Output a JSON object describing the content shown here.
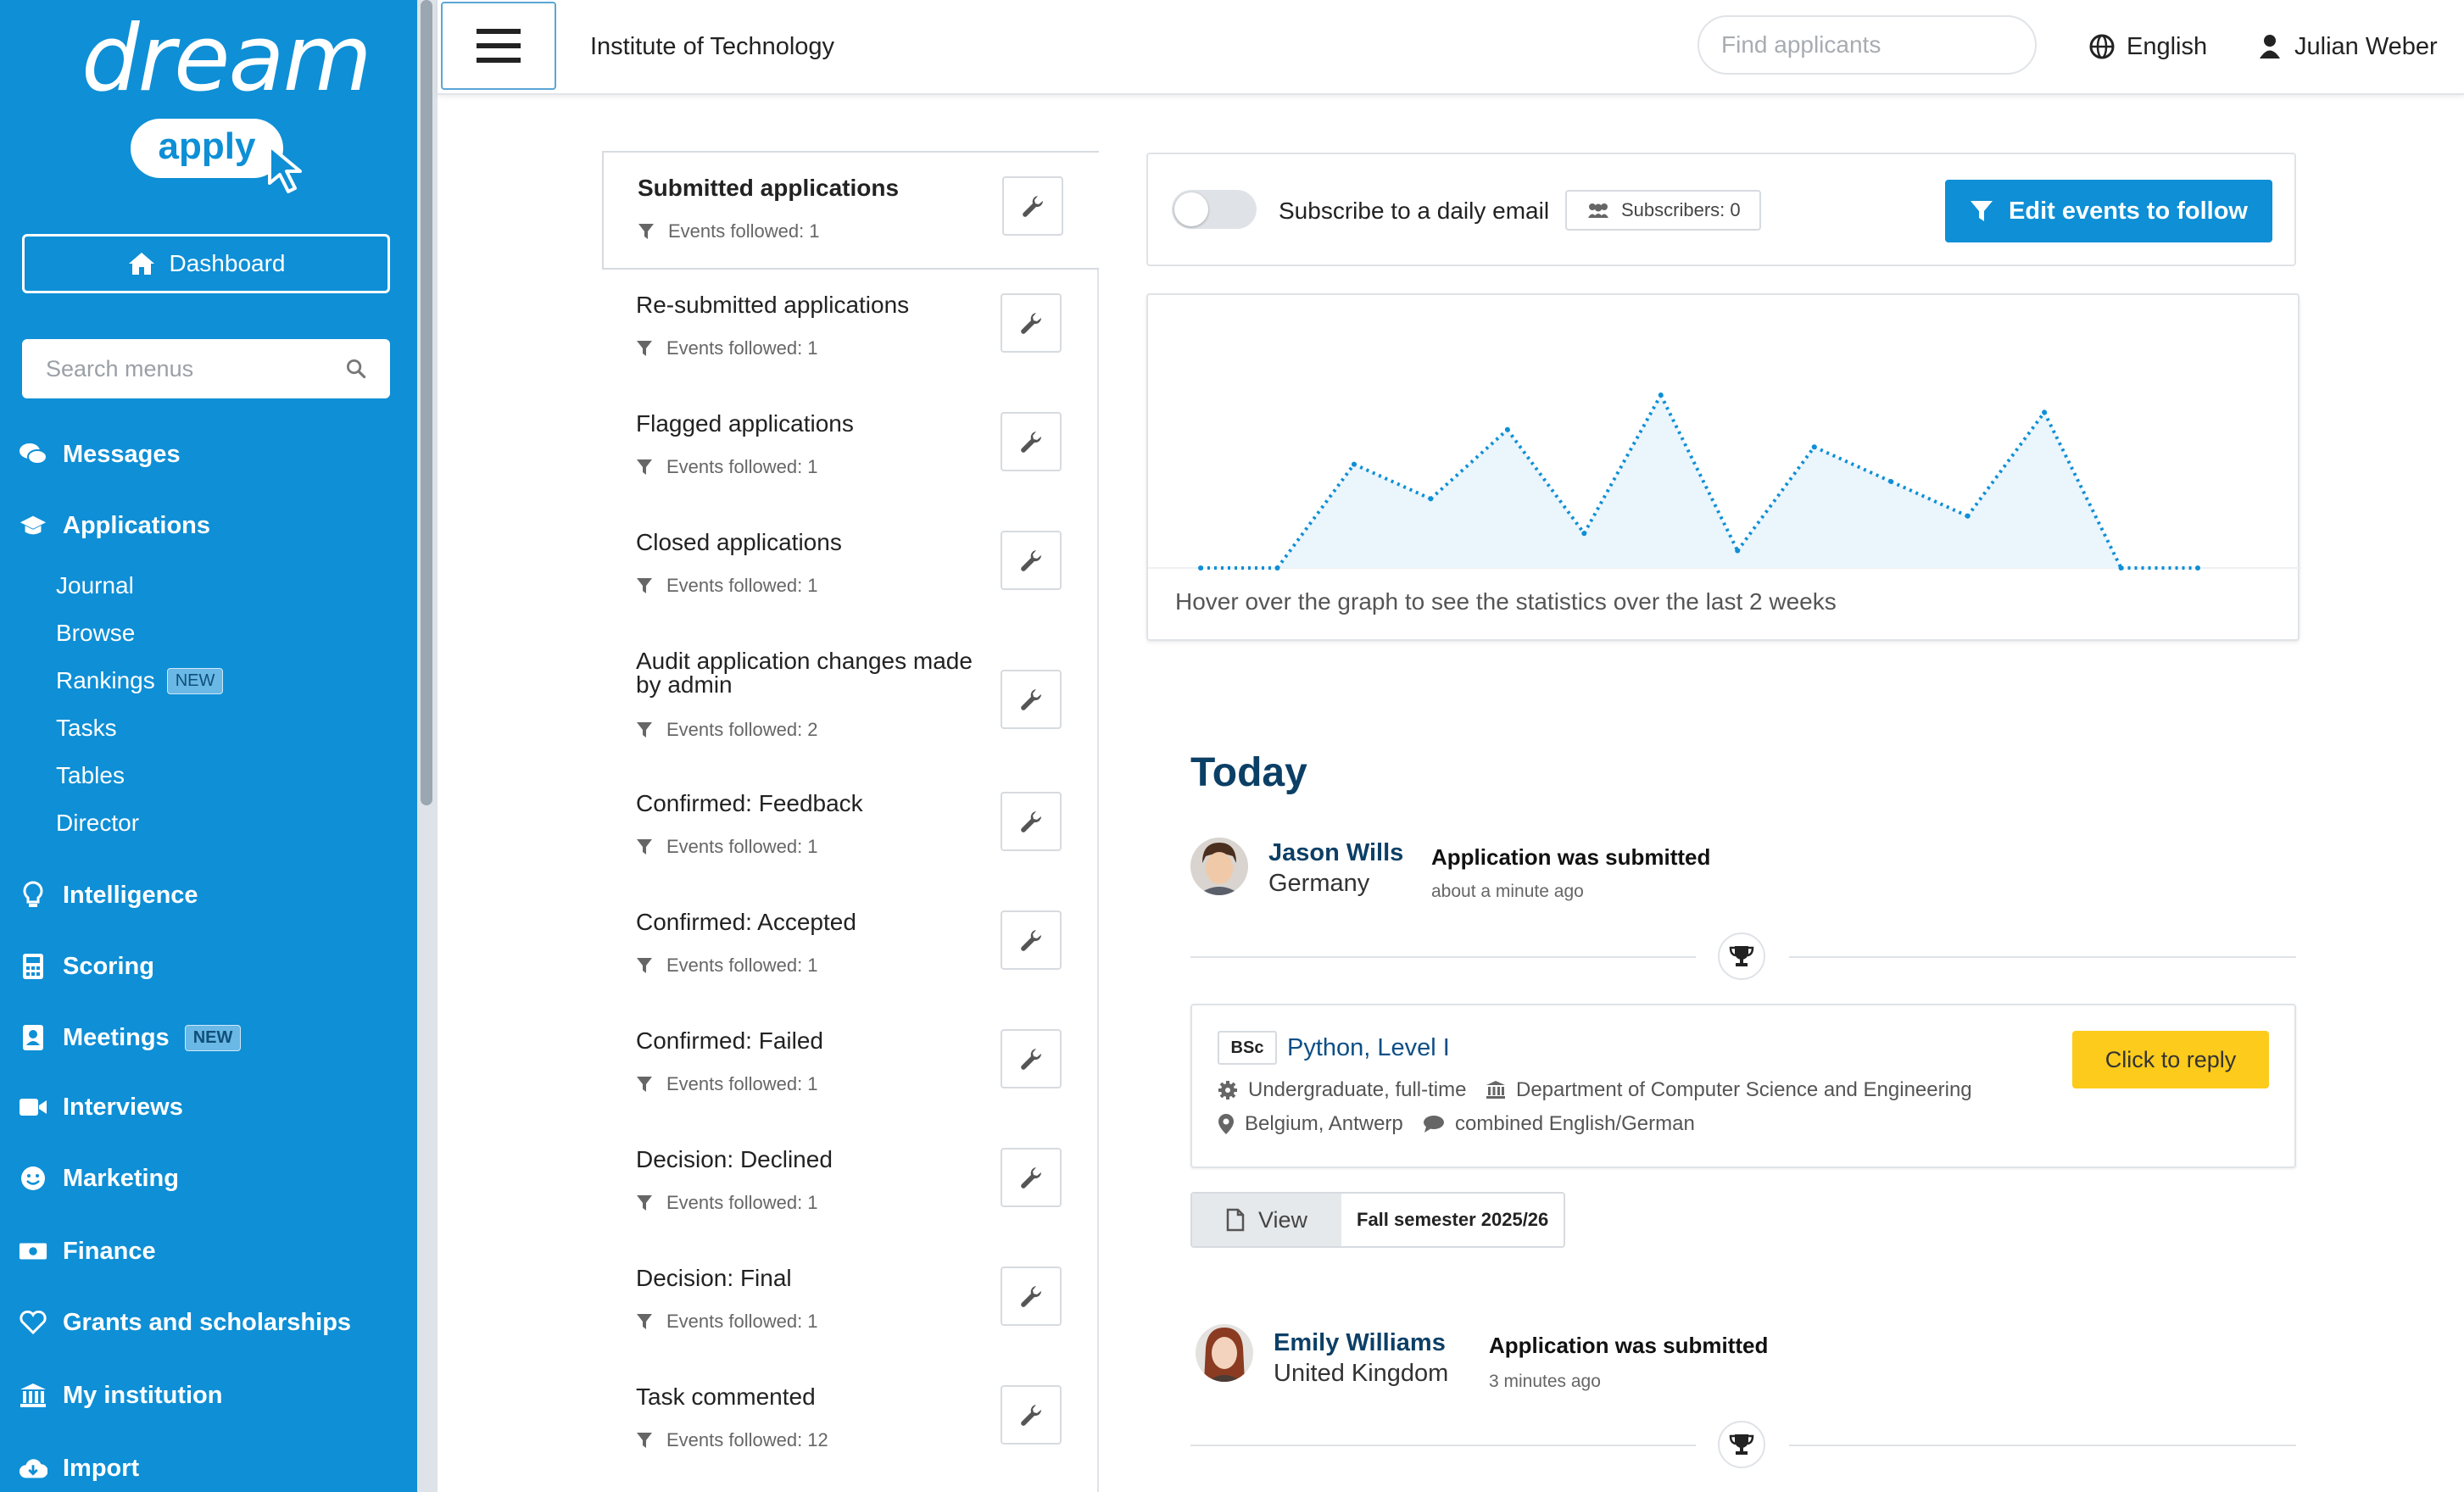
{
  "brand": {
    "word": "dream",
    "sub": "apply"
  },
  "sidebar": {
    "dashboard_label": "Dashboard",
    "search_placeholder": "Search menus",
    "nav": [
      {
        "label": "Messages",
        "icon": "comments-icon"
      },
      {
        "label": "Applications",
        "icon": "graduation-cap-icon"
      },
      {
        "label": "Intelligence",
        "icon": "lightbulb-icon"
      },
      {
        "label": "Scoring",
        "icon": "calculator-icon"
      },
      {
        "label": "Meetings",
        "icon": "address-book-icon",
        "badge": "NEW"
      },
      {
        "label": "Interviews",
        "icon": "video-icon"
      },
      {
        "label": "Marketing",
        "icon": "smile-icon"
      },
      {
        "label": "Finance",
        "icon": "money-bill-icon"
      },
      {
        "label": "Grants and scholarships",
        "icon": "heart-icon"
      },
      {
        "label": "My institution",
        "icon": "institution-icon"
      },
      {
        "label": "Import",
        "icon": "cloud-download-icon"
      }
    ],
    "applications_sub": [
      {
        "label": "Journal"
      },
      {
        "label": "Browse"
      },
      {
        "label": "Rankings",
        "badge": "NEW"
      },
      {
        "label": "Tasks"
      },
      {
        "label": "Tables"
      },
      {
        "label": "Director"
      }
    ]
  },
  "header": {
    "institution": "Institute of Technology",
    "find_placeholder": "Find applicants",
    "language": "English",
    "user": "Julian Weber"
  },
  "events": [
    {
      "title": "Submitted applications",
      "followed": "Events followed: 1",
      "active": true
    },
    {
      "title": "Re-submitted applications",
      "followed": "Events followed: 1"
    },
    {
      "title": "Flagged applications",
      "followed": "Events followed: 1"
    },
    {
      "title": "Closed applications",
      "followed": "Events followed: 1"
    },
    {
      "title": "Audit application changes made by admin",
      "followed": "Events followed: 2"
    },
    {
      "title": "Confirmed: Feedback",
      "followed": "Events followed: 1"
    },
    {
      "title": "Confirmed: Accepted",
      "followed": "Events followed: 1"
    },
    {
      "title": "Confirmed: Failed",
      "followed": "Events followed: 1"
    },
    {
      "title": "Decision: Declined",
      "followed": "Events followed: 1"
    },
    {
      "title": "Decision: Final",
      "followed": "Events followed: 1"
    },
    {
      "title": "Task commented",
      "followed": "Events followed: 12"
    }
  ],
  "subscribe": {
    "label": "Subscribe to a daily email",
    "subscribers": "Subscribers: 0",
    "edit_label": "Edit events to follow"
  },
  "graph": {
    "hint": "Hover over the graph to see the statistics over the last 2 weeks"
  },
  "chart_data": {
    "type": "area",
    "x": [
      1,
      2,
      3,
      4,
      5,
      6,
      7,
      8,
      9,
      10,
      11,
      12,
      13,
      14
    ],
    "values": [
      0,
      0,
      6,
      4,
      8,
      2,
      10,
      1,
      7,
      5,
      3,
      9,
      0,
      0
    ],
    "ylim": [
      0,
      10
    ],
    "grid": false
  },
  "feed": {
    "today_label": "Today",
    "items": [
      {
        "name": "Jason Wills",
        "country": "Germany",
        "event": "Application was submitted",
        "time": "about a minute ago"
      },
      {
        "name": "Emily Williams",
        "country": "United Kingdom",
        "event": "Application was submitted",
        "time": "3 minutes ago"
      }
    ],
    "program": {
      "degree": "BSc",
      "title": "Python, Level I",
      "study_mode": "Undergraduate, full-time",
      "department": "Department of Computer Science and Engineering",
      "location": "Belgium, Antwerp",
      "language": "combined English/German",
      "reply_label": "Click to reply"
    },
    "view_label": "View",
    "semester": "Fall semester 2025/26"
  },
  "colors": {
    "brand_blue": "#0e8fd6",
    "navy": "#0c3f66",
    "reply_yellow": "#fccb1c"
  }
}
